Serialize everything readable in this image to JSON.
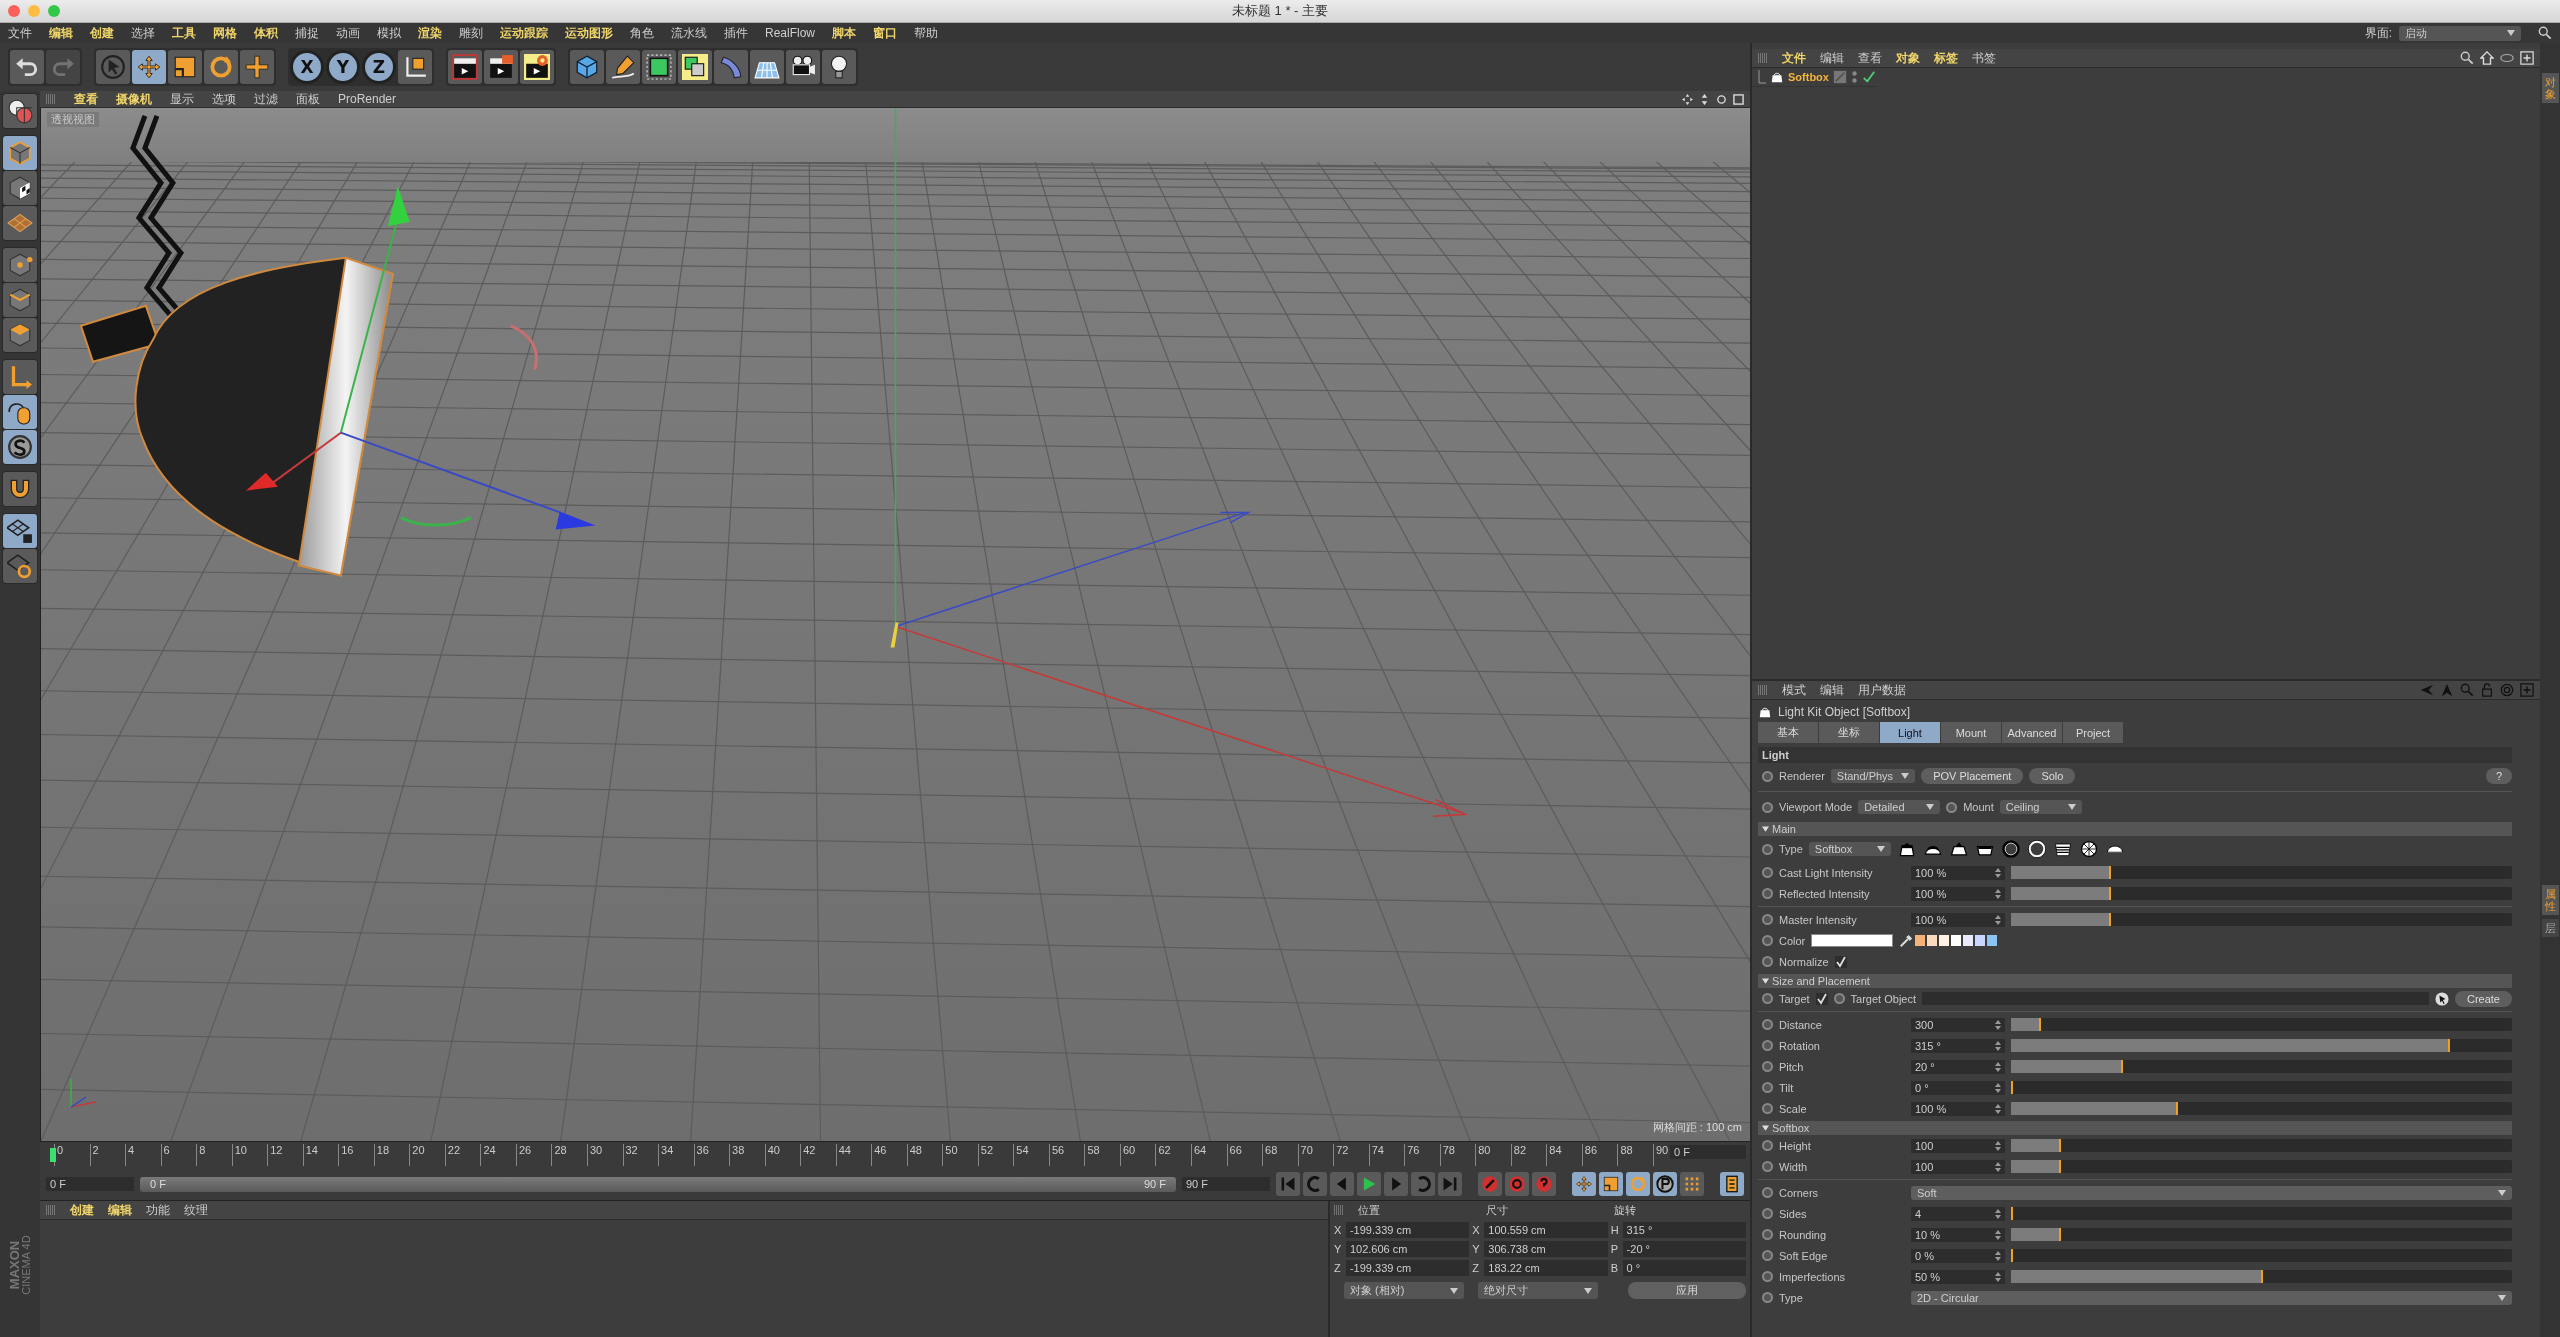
{
  "window": {
    "title": "未标题 1 * - 主要"
  },
  "menu_bar": {
    "items": [
      {
        "label": "文件",
        "accent": false
      },
      {
        "label": "编辑",
        "accent": true
      },
      {
        "label": "创建",
        "accent": true
      },
      {
        "label": "选择",
        "accent": false
      },
      {
        "label": "工具",
        "accent": true
      },
      {
        "label": "网格",
        "accent": true
      },
      {
        "label": "体积",
        "accent": true
      },
      {
        "label": "捕捉",
        "accent": false
      },
      {
        "label": "动画",
        "accent": false
      },
      {
        "label": "模拟",
        "accent": false
      },
      {
        "label": "渲染",
        "accent": true
      },
      {
        "label": "雕刻",
        "accent": false
      },
      {
        "label": "运动跟踪",
        "accent": true
      },
      {
        "label": "运动图形",
        "accent": true
      },
      {
        "label": "角色",
        "accent": false
      },
      {
        "label": "流水线",
        "accent": false
      },
      {
        "label": "插件",
        "accent": false
      },
      {
        "label": "RealFlow",
        "accent": false
      },
      {
        "label": "脚本",
        "accent": true
      },
      {
        "label": "窗口",
        "accent": true
      },
      {
        "label": "帮助",
        "accent": false
      }
    ],
    "layout_label": "界面:",
    "layout_value": "启动"
  },
  "toolbar": {
    "groups": [
      [
        {
          "kind": "undo",
          "selected": false,
          "disabled": false
        },
        {
          "kind": "redo",
          "selected": false,
          "disabled": true
        }
      ],
      [
        {
          "kind": "select",
          "selected": false,
          "disabled": false
        },
        {
          "kind": "move",
          "selected": true,
          "disabled": false
        },
        {
          "kind": "scale",
          "selected": false,
          "disabled": false
        },
        {
          "kind": "rotate",
          "selected": false,
          "disabled": false
        },
        {
          "kind": "add",
          "selected": false,
          "disabled": false
        }
      ],
      [
        {
          "kind": "axis",
          "label": "X",
          "selected": true,
          "disabled": false
        },
        {
          "kind": "axis",
          "label": "Y",
          "selected": true,
          "disabled": false
        },
        {
          "kind": "axis",
          "label": "Z",
          "selected": true,
          "disabled": false
        },
        {
          "kind": "coords",
          "selected": false,
          "disabled": false
        }
      ],
      [
        {
          "kind": "render-view",
          "selected": false,
          "disabled": false
        },
        {
          "kind": "render-picture",
          "selected": false,
          "disabled": false
        },
        {
          "kind": "render-settings",
          "selected": false,
          "disabled": false
        }
      ],
      [
        {
          "kind": "cube",
          "selected": false,
          "disabled": false
        },
        {
          "kind": "pen",
          "selected": false,
          "disabled": false
        },
        {
          "kind": "subdivide",
          "selected": false,
          "disabled": false
        },
        {
          "kind": "cloner",
          "selected": false,
          "disabled": false
        },
        {
          "kind": "deformer",
          "selected": false,
          "disabled": false
        },
        {
          "kind": "floor",
          "selected": false,
          "disabled": false
        },
        {
          "kind": "camera",
          "selected": false,
          "disabled": false
        },
        {
          "kind": "light",
          "selected": false,
          "disabled": false
        }
      ]
    ]
  },
  "left_toolbar": {
    "groups": [
      [
        {
          "kind": "globe",
          "selected": false
        }
      ],
      [
        {
          "kind": "model",
          "selected": true
        },
        {
          "kind": "texture",
          "selected": false
        },
        {
          "kind": "workplane",
          "selected": false
        }
      ],
      [
        {
          "kind": "points",
          "selected": false
        },
        {
          "kind": "edges",
          "selected": false
        },
        {
          "kind": "polygons",
          "selected": false
        }
      ],
      [
        {
          "kind": "axis-tool",
          "selected": false
        },
        {
          "kind": "mouse",
          "selected": true
        },
        {
          "kind": "snap",
          "selected": true
        }
      ],
      [
        {
          "kind": "magnet",
          "selected": false
        }
      ],
      [
        {
          "kind": "grid-lock",
          "selected": true
        },
        {
          "kind": "grid-cycle",
          "selected": false
        }
      ]
    ]
  },
  "viewport": {
    "menu": [
      {
        "label": "查看",
        "accent": true
      },
      {
        "label": "摄像机",
        "accent": true
      },
      {
        "label": "显示",
        "accent": false
      },
      {
        "label": "选项",
        "accent": false
      },
      {
        "label": "过滤",
        "accent": false
      },
      {
        "label": "面板",
        "accent": false
      },
      {
        "label": "ProRender",
        "accent": false
      }
    ],
    "view_name": "透视视图",
    "grid_spacing": "网格间距 : 100 cm"
  },
  "timeline": {
    "ticks": [
      "0",
      "2",
      "4",
      "6",
      "8",
      "10",
      "12",
      "14",
      "16",
      "18",
      "20",
      "22",
      "24",
      "26",
      "28",
      "30",
      "32",
      "34",
      "36",
      "38",
      "40",
      "42",
      "44",
      "46",
      "48",
      "50",
      "52",
      "54",
      "56",
      "58",
      "60",
      "62",
      "64",
      "66",
      "68",
      "70",
      "72",
      "74",
      "76",
      "78",
      "80",
      "82",
      "84",
      "86",
      "88",
      "90"
    ],
    "current_frame": "0 F",
    "start_field": "0 F",
    "range": {
      "start": "0 F",
      "end": "90 F",
      "level": 1
    },
    "end_field": "90 F"
  },
  "materials": {
    "menu": [
      {
        "label": "创建",
        "accent": true
      },
      {
        "label": "编辑",
        "accent": true
      },
      {
        "label": "功能",
        "accent": false
      },
      {
        "label": "纹理",
        "accent": false
      }
    ]
  },
  "coordinates": {
    "headers": [
      "位置",
      "尺寸",
      "旋转"
    ],
    "rows": [
      {
        "axis": "X",
        "position": "-199.339 cm",
        "size_axis": "X",
        "size": "100.559 cm",
        "rot_axis": "H",
        "rotation": "315 °"
      },
      {
        "axis": "Y",
        "position": "102.606 cm",
        "size_axis": "Y",
        "size": "306.738 cm",
        "rot_axis": "P",
        "rotation": "-20 °"
      },
      {
        "axis": "Z",
        "position": "-199.339 cm",
        "size_axis": "Z",
        "size": "183.22 cm",
        "rot_axis": "B",
        "rotation": "0 °"
      }
    ],
    "mode_dropdown": "对象 (相对)",
    "size_dropdown": "绝对尺寸",
    "apply_button": "应用"
  },
  "logo": {
    "brand": "MAXON",
    "product": "CINEMA 4D"
  },
  "object_manager": {
    "menu": [
      {
        "label": "文件",
        "accent": true
      },
      {
        "label": "编辑",
        "accent": false
      },
      {
        "label": "查看",
        "accent": false
      },
      {
        "label": "对象",
        "accent": true
      },
      {
        "label": "标签",
        "accent": true
      },
      {
        "label": "书签",
        "accent": false
      }
    ],
    "objects": [
      {
        "name": "Softbox",
        "selected": true,
        "enabled": true
      }
    ]
  },
  "attributes": {
    "menu": [
      {
        "label": "模式",
        "accent": false
      },
      {
        "label": "编辑",
        "accent": false
      },
      {
        "label": "用户数据",
        "accent": false
      }
    ],
    "object_title": "Light Kit Object [Softbox]",
    "tabs": [
      {
        "label": "基本",
        "selected": false
      },
      {
        "label": "坐标",
        "selected": false
      },
      {
        "label": "Light",
        "selected": true
      },
      {
        "label": "Mount",
        "selected": false
      },
      {
        "label": "Advanced",
        "selected": false
      },
      {
        "label": "Project",
        "selected": false
      }
    ],
    "header": "Light",
    "renderer": {
      "label": "Renderer",
      "value": "Stand/Phys",
      "buttons": [
        "POV Placement",
        "Solo"
      ],
      "help": "?"
    },
    "viewport_mode": {
      "label": "Viewport Mode",
      "value": "Detailed"
    },
    "mount": {
      "label": "Mount",
      "value": "Ceiling"
    },
    "groups": [
      {
        "title": "Main",
        "expanded": true,
        "rows": [
          {
            "kind": "type",
            "label": "Type",
            "value": "Softbox",
            "separated": false
          },
          {
            "kind": "slider",
            "label": "Cast Light Intensity",
            "value": "100 %",
            "level": 0.2,
            "separated": false
          },
          {
            "kind": "slider",
            "label": "Reflected Intensity",
            "value": "100 %",
            "level": 0.2,
            "separated": false
          },
          {
            "kind": "slider",
            "label": "Master Intensity",
            "value": "100 %",
            "level": 0.2,
            "separated": true
          },
          {
            "kind": "color",
            "label": "Color",
            "swatch": {
              "color": "#ffffff"
            },
            "presets": [
              {
                "color": "#f5b27a"
              },
              {
                "color": "#fbd9bd"
              },
              {
                "color": "#fdf0e4"
              },
              {
                "color": "#ffffff"
              },
              {
                "color": "#e8e9ff"
              },
              {
                "color": "#c9d6ff"
              },
              {
                "color": "#8cc4f5"
              }
            ],
            "separated": false
          },
          {
            "kind": "check",
            "label": "Normalize",
            "checked": true,
            "separated": false
          }
        ]
      },
      {
        "title": "Size and Placement",
        "expanded": true,
        "rows": [
          {
            "kind": "target",
            "label": "Target",
            "checked": true,
            "object_label": "Target Object",
            "button": "Create",
            "separated": false
          },
          {
            "kind": "slider",
            "label": "Distance",
            "value": "300",
            "level": 0.06,
            "separated": true
          },
          {
            "kind": "slider",
            "label": "Rotation",
            "value": "315 °",
            "level": 0.877,
            "separated": false
          },
          {
            "kind": "slider",
            "label": "Pitch",
            "value": "20 °",
            "level": 0.223,
            "separated": false
          },
          {
            "kind": "slider",
            "label": "Tilt",
            "value": "0 °",
            "level": 0,
            "separated": false
          },
          {
            "kind": "slider",
            "label": "Scale",
            "value": "100 %",
            "level": 0.334,
            "separated": false
          }
        ]
      },
      {
        "title": "Softbox",
        "expanded": true,
        "rows": [
          {
            "kind": "slider",
            "label": "Height",
            "value": "100",
            "level": 0.1,
            "separated": false
          },
          {
            "kind": "slider",
            "label": "Width",
            "value": "100",
            "level": 0.1,
            "separated": false
          },
          {
            "kind": "dropdown",
            "label": "Corners",
            "value": "Soft",
            "separated": true
          },
          {
            "kind": "slider",
            "label": "Sides",
            "value": "4",
            "level": 0,
            "separated": false
          },
          {
            "kind": "slider",
            "label": "Rounding",
            "value": "10 %",
            "level": 0.1,
            "separated": false
          },
          {
            "kind": "slider",
            "label": "Soft Edge",
            "value": "0 %",
            "level": 0,
            "separated": false
          },
          {
            "kind": "slider",
            "label": "Imperfections",
            "value": "50 %",
            "level": 0.503,
            "separated": false
          },
          {
            "kind": "dropdown",
            "label": "Type",
            "value": "2D - Circular",
            "separated": false
          }
        ]
      }
    ]
  },
  "side_tabs": {
    "top": [
      {
        "label": "对象",
        "selected": true
      }
    ],
    "bottom": [
      {
        "label": "属性",
        "selected": true
      },
      {
        "label": "层",
        "selected": false
      }
    ]
  }
}
